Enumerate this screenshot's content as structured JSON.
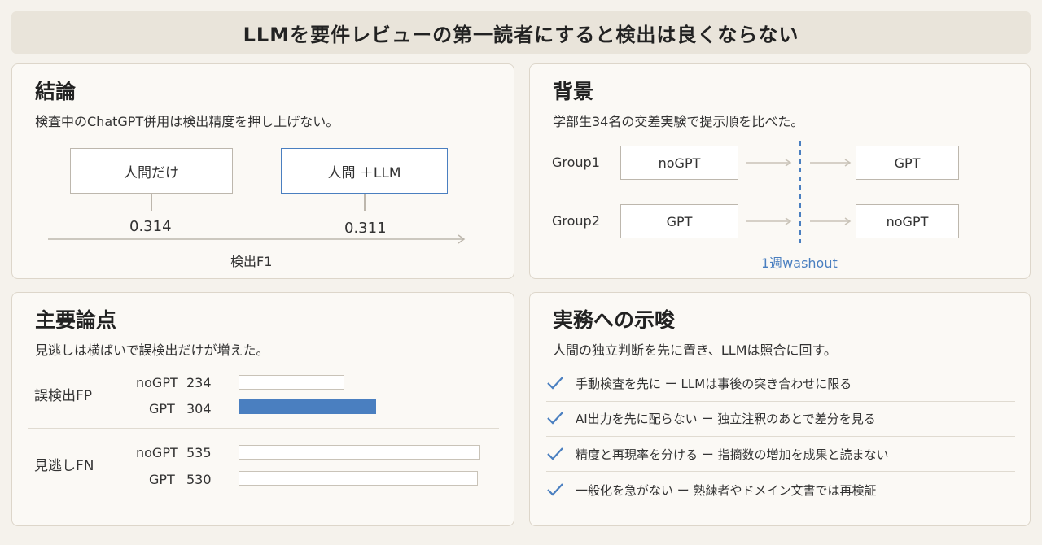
{
  "title": "LLMを要件レビューの第一読者にすると検出は良くならない",
  "conclusion": {
    "title": "結論",
    "subtitle": "検査中のChatGPT併用は検出精度を押し上げない。",
    "box_human": "人間だけ",
    "box_llm": "人間 ＋LLM",
    "value_human": "0.314",
    "value_llm": "0.311",
    "axis_label": "検出F1"
  },
  "background": {
    "title": "背景",
    "subtitle": "学部生34名の交差実験で提示順を比べた。",
    "groups": [
      {
        "label": "Group1",
        "first": "noGPT",
        "second": "GPT"
      },
      {
        "label": "Group2",
        "first": "GPT",
        "second": "noGPT"
      }
    ],
    "washout": "1週washout",
    "accent": "#4a7fc0"
  },
  "findings": {
    "title": "主要論点",
    "subtitle": "見逃しは横ばいで誤検出だけが増えた。",
    "chart_data": {
      "type": "bar",
      "orientation": "horizontal",
      "groups": [
        {
          "label": "誤検出FP",
          "rows": [
            {
              "name": "noGPT",
              "value": 234
            },
            {
              "name": "GPT",
              "value": 304,
              "highlight": true
            }
          ]
        },
        {
          "label": "見逃しFN",
          "rows": [
            {
              "name": "noGPT",
              "value": 535
            },
            {
              "name": "GPT",
              "value": 530
            }
          ]
        }
      ]
    }
  },
  "implications": {
    "title": "実務への示唆",
    "subtitle": "人間の独立判断を先に置き、LLMは照合に回す。",
    "items": [
      "手動検査を先に ー LLMは事後の突き合わせに限る",
      "AI出力を先に配らない ー 独立注釈のあとで差分を見る",
      "精度と再現率を分ける ー 指摘数の増加を成果と読まない",
      "一般化を急がない ー 熟練者やドメイン文書では再検証"
    ],
    "check_icon": "check-icon"
  }
}
